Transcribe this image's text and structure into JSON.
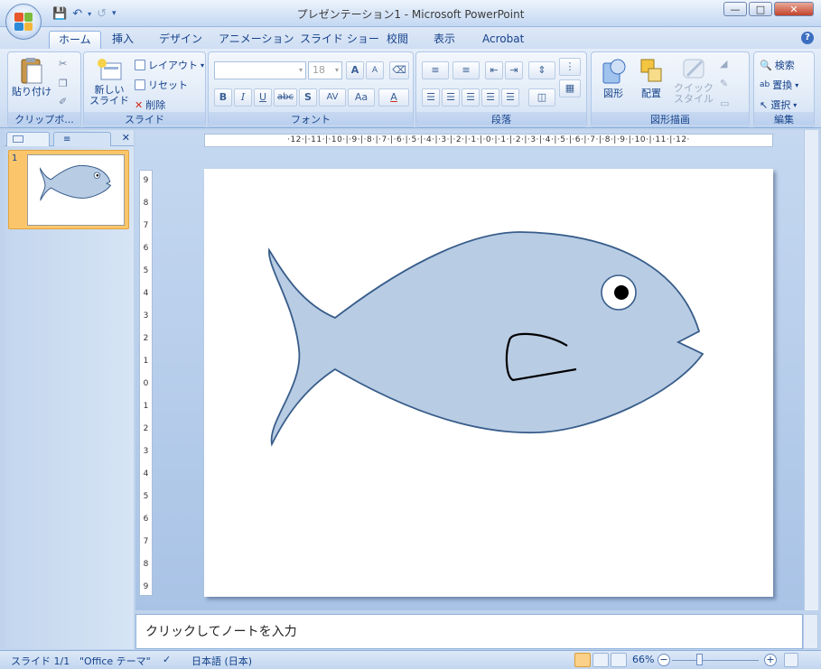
{
  "window": {
    "title": "プレゼンテーション1 - Microsoft PowerPoint"
  },
  "tabs": [
    "ホーム",
    "挿入",
    "デザイン",
    "アニメーション",
    "スライド ショー",
    "校閲",
    "表示",
    "Acrobat"
  ],
  "ribbon": {
    "clipboard": {
      "paste": "貼り付け",
      "label": "クリップボ..."
    },
    "slides": {
      "new_slide_1": "新しい",
      "new_slide_2": "スライド",
      "layout": "レイアウト",
      "reset": "リセット",
      "delete": "削除",
      "label": "スライド"
    },
    "font": {
      "font_size": "18",
      "label": "フォント",
      "grow": "A",
      "shrink": "A",
      "bold": "B",
      "italic": "I",
      "underline": "U",
      "strike": "abc",
      "shadow": "S",
      "spacing": "AV",
      "case": "Aa",
      "color": "A"
    },
    "paragraph": {
      "label": "段落"
    },
    "drawing": {
      "shapes": "図形",
      "arrange": "配置",
      "quick_styles_1": "クイック",
      "quick_styles_2": "スタイル",
      "label": "図形描画"
    },
    "editing": {
      "find": "検索",
      "replace": "置換",
      "select": "選択",
      "label": "編集"
    }
  },
  "slides_pane": {
    "slide_number": "1"
  },
  "ruler": {
    "horizontal": "·12·|·11·|·10·|·9·|·8·|·7·|·6·|·5·|·4·|·3·|·2·|·1·|·0·|·1·|·2·|·3·|·4·|·5·|·6·|·7·|·8·|·9·|·10·|·11·|·12·",
    "vertical": [
      "9",
      "8",
      "7",
      "6",
      "5",
      "4",
      "3",
      "2",
      "1",
      "0",
      "1",
      "2",
      "3",
      "4",
      "5",
      "6",
      "7",
      "8",
      "9"
    ]
  },
  "notes": {
    "placeholder": "クリックしてノートを入力"
  },
  "status": {
    "slide": "スライド 1/1",
    "theme": "\"Office テーマ\"",
    "language": "日本語 (日本)",
    "zoom": "66%"
  },
  "colors": {
    "fish_fill": "#b8cce4",
    "fish_stroke": "#385d8a",
    "thumb_highlight": "#fbc66b"
  }
}
